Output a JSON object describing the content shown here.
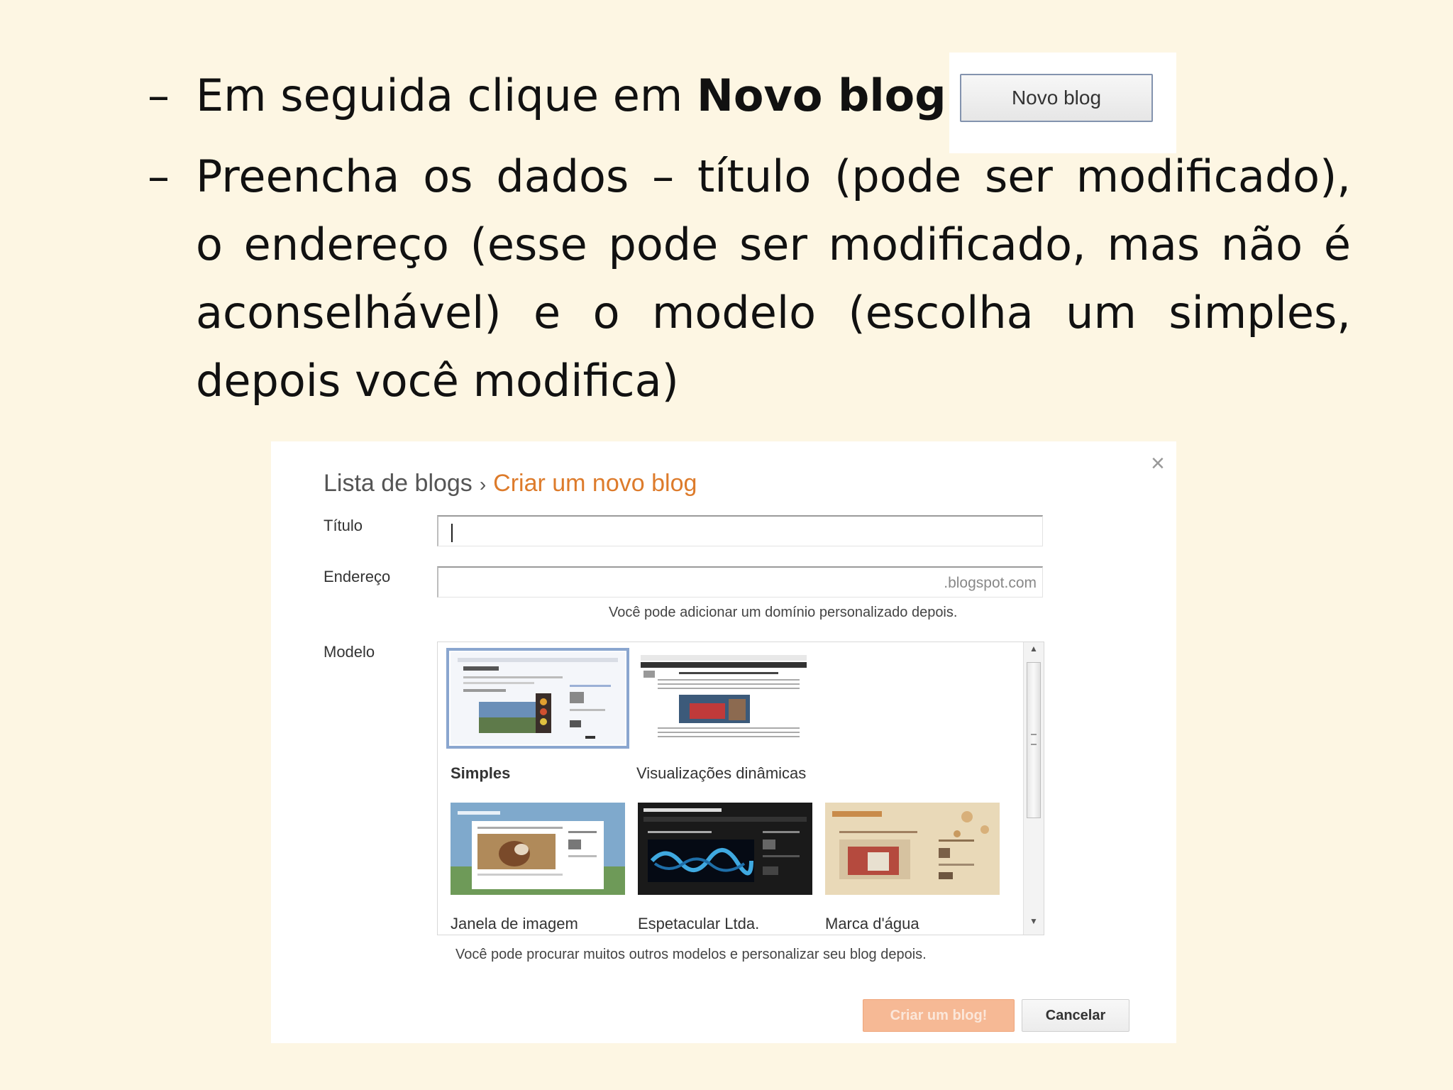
{
  "slide": {
    "bullet_marker": "–",
    "bullet1_text": "Em seguida clique em ",
    "bullet1_bold": "Novo blog",
    "novo_blog_button": "Novo blog",
    "bullet2_lines": [
      "Preencha os dados – título (pode ser modificado),",
      "o endereço (esse pode ser modificado, mas não é",
      "aconselhável) e o modelo (escolha um simples,",
      "depois você modifica)"
    ]
  },
  "dialog": {
    "close_icon": "×",
    "breadcrumb": {
      "parent": "Lista de blogs",
      "separator": "›",
      "current": "Criar um novo blog"
    },
    "title_label": "Título",
    "title_value": "",
    "address_label": "Endereço",
    "address_value": "",
    "address_suffix": ".blogspot.com",
    "address_hint": "Você pode adicionar um domínio personalizado depois.",
    "template_label": "Modelo",
    "templates": [
      {
        "name": "Simples",
        "selected": true
      },
      {
        "name": "Visualizações dinâmicas",
        "selected": false
      },
      {
        "name": "Janela de imagem",
        "selected": false
      },
      {
        "name": "Espetacular Ltda.",
        "selected": false
      },
      {
        "name": "Marca d'água",
        "selected": false
      }
    ],
    "template_hint": "Você pode procurar muitos outros modelos e personalizar seu blog depois.",
    "create_button": "Criar um blog!",
    "cancel_button": "Cancelar"
  },
  "colors": {
    "background": "#FDF6E3",
    "breadcrumb_current": "#DD7B2B",
    "create_button": "#F6B995",
    "selected_outline": "#8AA6CF"
  }
}
